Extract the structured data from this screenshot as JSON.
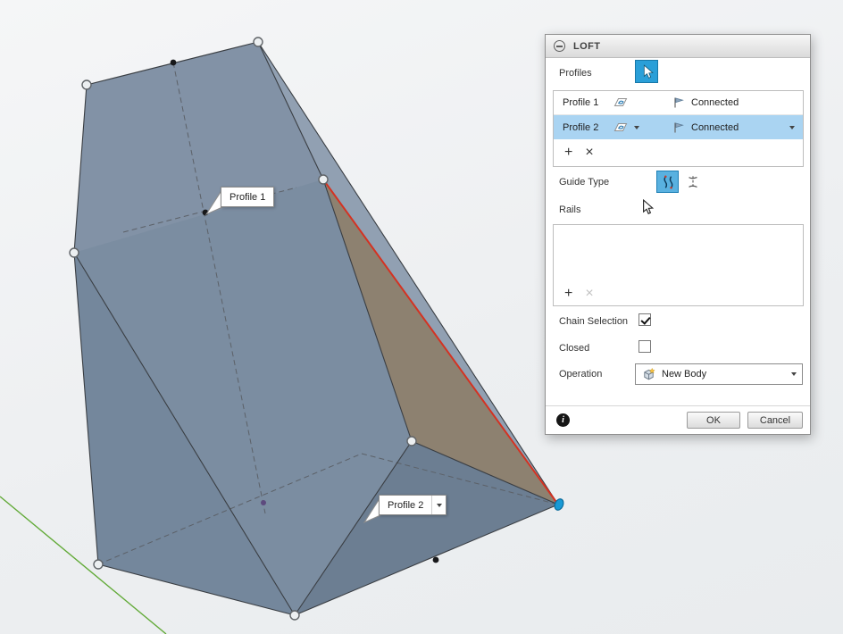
{
  "viewport": {
    "profile1_label": "Profile 1",
    "profile2_label": "Profile 2"
  },
  "dialog": {
    "title": "LOFT",
    "profiles_label": "Profiles",
    "profile_rows": [
      {
        "name": "Profile 1",
        "status": "Connected"
      },
      {
        "name": "Profile 2",
        "status": "Connected"
      }
    ],
    "table_actions": {
      "add": "+",
      "remove": "×"
    },
    "guide_type_label": "Guide Type",
    "rails_label": "Rails",
    "rails_actions": {
      "add": "+",
      "remove": "×"
    },
    "chain_selection_label": "Chain Selection",
    "closed_label": "Closed",
    "operation_label": "Operation",
    "operation_value": "New Body",
    "footer": {
      "info": "i",
      "ok": "OK",
      "cancel": "Cancel"
    }
  },
  "colors": {
    "selection_blue": "#2a9fd8",
    "row_highlight": "#aad4f2",
    "edge_highlight": "#d43222",
    "body_face": "#7b8da1",
    "body_face_tan": "#8d8170",
    "axis_green": "#62aa38"
  }
}
